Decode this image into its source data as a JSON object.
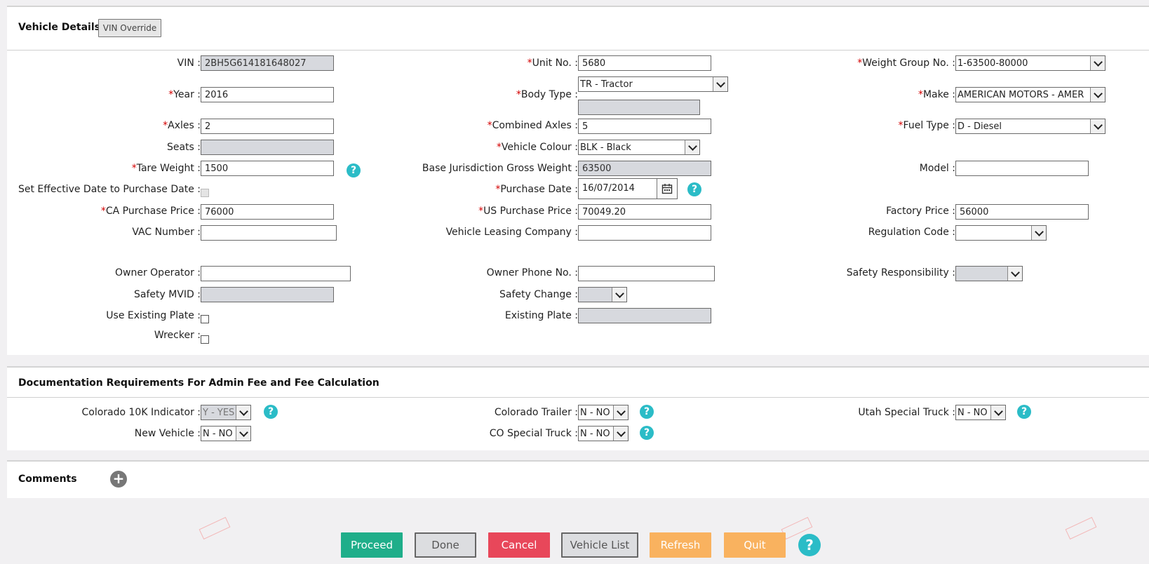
{
  "vehicle_details": {
    "title": "Vehicle Details",
    "vin_override_button": "VIN Override",
    "labels": {
      "vin": "VIN",
      "year": "Year",
      "axles": "Axles",
      "seats": "Seats",
      "tare_weight": "Tare Weight",
      "set_effective_date": "Set Effective Date to Purchase Date",
      "ca_purchase_price": "CA Purchase Price",
      "vac_number": "VAC Number",
      "owner_operator": "Owner Operator",
      "safety_mvid": "Safety MVID",
      "use_existing_plate": "Use Existing Plate",
      "wrecker": "Wrecker",
      "unit_no": "Unit No.",
      "body_type": "Body Type",
      "combined_axles": "Combined Axles",
      "vehicle_colour": "Vehicle Colour",
      "base_jurisdiction_gross_weight": "Base Jurisdiction Gross Weight",
      "purchase_date": "Purchase Date",
      "us_purchase_price": "US Purchase Price",
      "vehicle_leasing_company": "Vehicle Leasing Company",
      "owner_phone_no": "Owner Phone No.",
      "safety_change": "Safety Change",
      "existing_plate": "Existing Plate",
      "weight_group_no": "Weight Group No.",
      "make": "Make",
      "fuel_type": "Fuel Type",
      "model": "Model",
      "factory_price": "Factory Price",
      "regulation_code": "Regulation Code",
      "safety_responsibility": "Safety Responsibility"
    },
    "values": {
      "vin": "2BH5G614181648027",
      "year": "2016",
      "axles": "2",
      "seats": "",
      "tare_weight": "1500",
      "ca_purchase_price": "76000",
      "vac_number": "",
      "owner_operator": "",
      "safety_mvid": "",
      "unit_no": "5680",
      "body_type": "TR - Tractor",
      "body_type_extra": "",
      "combined_axles": "5",
      "vehicle_colour": "BLK - Black",
      "base_jurisdiction_gross_weight": "63500",
      "purchase_date": "16/07/2014",
      "us_purchase_price": "70049.20",
      "vehicle_leasing_company": "",
      "owner_phone_no": "",
      "safety_change": "",
      "existing_plate": "",
      "weight_group_no": "1-63500-80000",
      "make": "AMERICAN MOTORS - AMER",
      "fuel_type": "D - Diesel",
      "model": "",
      "factory_price": "56000",
      "regulation_code": "",
      "safety_responsibility": ""
    }
  },
  "documentation": {
    "title": "Documentation Requirements For Admin Fee and Fee Calculation",
    "labels": {
      "colorado_10k": "Colorado 10K Indicator",
      "new_vehicle": "New Vehicle",
      "colorado_trailer": "Colorado Trailer",
      "co_special_truck": "CO Special Truck",
      "utah_special_truck": "Utah Special Truck"
    },
    "values": {
      "colorado_10k": "Y - YES",
      "new_vehicle": "N - NO",
      "colorado_trailer": "N - NO",
      "co_special_truck": "N - NO",
      "utah_special_truck": "N - NO"
    }
  },
  "comments": {
    "title": "Comments"
  },
  "footer": {
    "proceed": "Proceed",
    "done": "Done",
    "cancel": "Cancel",
    "vehicle_list": "Vehicle List",
    "refresh": "Refresh",
    "quit": "Quit"
  },
  "symbols": {
    "required": "*",
    "colon": ":",
    "help": "?",
    "plus": "+"
  },
  "colors": {
    "proceed": "#1fae8a",
    "cancel": "#e8475a",
    "refresh": "#f9b25f",
    "quit": "#f9b25f",
    "help": "#2bbcc7",
    "required": "#d40000"
  }
}
